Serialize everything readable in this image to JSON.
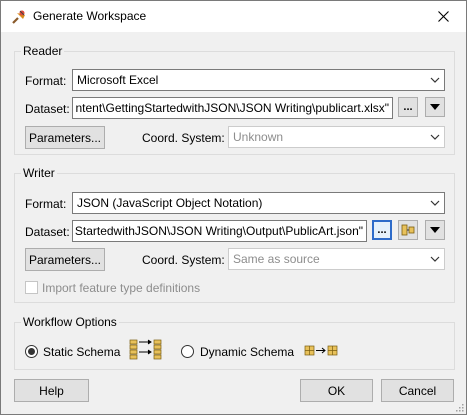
{
  "window": {
    "title": "Generate Workspace",
    "app_icon": "fme-workspace-icon",
    "close_icon": "close-icon"
  },
  "reader": {
    "group_label": "Reader",
    "format_label": "Format:",
    "format_value": "Microsoft Excel",
    "dataset_label": "Dataset:",
    "dataset_value": "ntent\\GettingStartedwithJSON\\JSON Writing\\publicart.xlsx\"",
    "browse_label": "...",
    "parameters_label": "Parameters...",
    "coord_label": "Coord. System:",
    "coord_value": "Unknown"
  },
  "writer": {
    "group_label": "Writer",
    "format_label": "Format:",
    "format_value": "JSON (JavaScript Object Notation)",
    "dataset_label": "Dataset:",
    "dataset_value": "StartedwithJSON\\JSON Writing\\Output\\PublicArt.json\"",
    "browse_label": "...",
    "parameters_label": "Parameters...",
    "coord_label": "Coord. System:",
    "coord_value": "Same as source",
    "import_label": "Import feature type definitions",
    "import_checked": false
  },
  "workflow": {
    "group_label": "Workflow Options",
    "static_label": "Static Schema",
    "dynamic_label": "Dynamic Schema",
    "selected": "static"
  },
  "footer": {
    "help_label": "Help",
    "ok_label": "OK",
    "cancel_label": "Cancel"
  },
  "colors": {
    "accent": "#0078d7",
    "window_bg": "#f0f0f0"
  }
}
